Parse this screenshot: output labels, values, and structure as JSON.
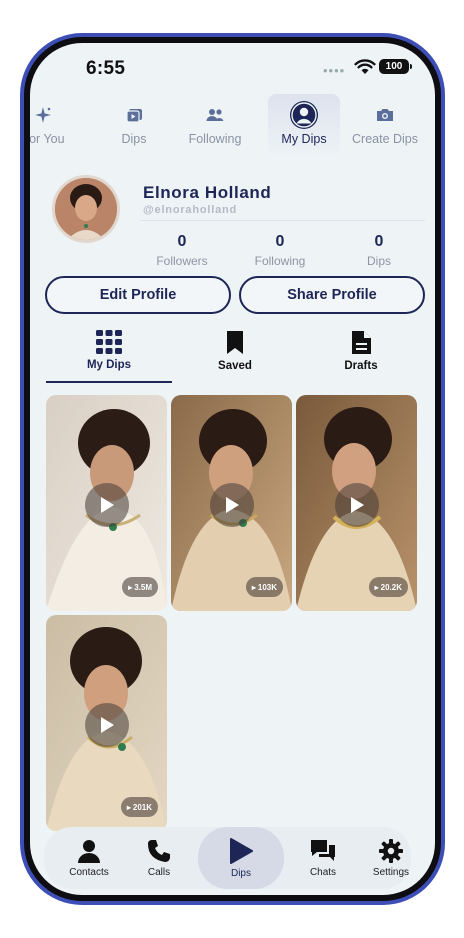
{
  "status": {
    "time": "6:55",
    "battery": "100"
  },
  "top_nav": [
    {
      "label": "For You",
      "icon": "sparkle-icon"
    },
    {
      "label": "Dips",
      "icon": "video-icon"
    },
    {
      "label": "Following",
      "icon": "people-icon"
    },
    {
      "label": "My Dips",
      "icon": "user-avatar-icon"
    },
    {
      "label": "Create Dips",
      "icon": "camera-icon"
    }
  ],
  "profile": {
    "name": "Elnora Holland",
    "handle": "@elnoraholland",
    "stats": [
      {
        "value": "0",
        "label": "Followers"
      },
      {
        "value": "0",
        "label": "Following"
      },
      {
        "value": "0",
        "label": "Dips"
      }
    ],
    "edit_label": "Edit Profile",
    "share_label": "Share Profile"
  },
  "content_tabs": [
    {
      "label": "My Dips",
      "icon": "grid-icon"
    },
    {
      "label": "Saved",
      "icon": "bookmark-icon"
    },
    {
      "label": "Drafts",
      "icon": "document-icon"
    }
  ],
  "videos": [
    {
      "views": "3.5M"
    },
    {
      "views": "103K"
    },
    {
      "views": "20.2K"
    },
    {
      "views": "201K"
    }
  ],
  "bottom_nav": [
    {
      "label": "Contacts",
      "icon": "person-icon"
    },
    {
      "label": "Calls",
      "icon": "phone-icon"
    },
    {
      "label": "Dips",
      "icon": "play-icon"
    },
    {
      "label": "Chats",
      "icon": "chat-icon"
    },
    {
      "label": "Settings",
      "icon": "gear-icon"
    }
  ],
  "colors": {
    "primary": "#1d2656",
    "background": "#eef3f6",
    "frame": "#3d4fb6"
  }
}
